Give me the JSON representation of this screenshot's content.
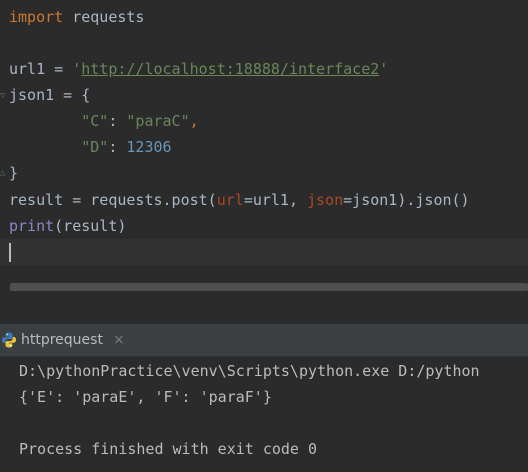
{
  "editor": {
    "line1": {
      "kw": "import",
      "rest": " requests"
    },
    "line3": {
      "var": "url1 = ",
      "q1": "'",
      "url": "http://localhost:18888/interface2",
      "q2": "'"
    },
    "line4": {
      "text": "json1 = {"
    },
    "line5": {
      "indent": "        ",
      "key": "\"C\"",
      "colon": ": ",
      "val": "\"paraC\"",
      "comma": ","
    },
    "line6": {
      "indent": "        ",
      "key": "\"D\"",
      "colon": ": ",
      "val": "12306"
    },
    "line7": {
      "text": "}"
    },
    "line8": {
      "start": "result = requests.post(",
      "p1": "url",
      "mid1": "=url1, ",
      "p2": "json",
      "mid2": "=json1).json()"
    },
    "line9": {
      "fn": "print",
      "rest": "(result)"
    }
  },
  "run_panel": {
    "tab_label": "httprequest",
    "close_glyph": "×",
    "console_lines": [
      "D:\\pythonPractice\\venv\\Scripts\\python.exe D:/python",
      "{'E': 'paraE', 'F': 'paraF'}",
      "",
      "Process finished with exit code 0"
    ]
  },
  "colors": {
    "background": "#2b2b2b",
    "keyword": "#cc7832",
    "string": "#6a8759",
    "number": "#6897bb",
    "parameter": "#aa4926",
    "builtin": "#8888c6"
  }
}
